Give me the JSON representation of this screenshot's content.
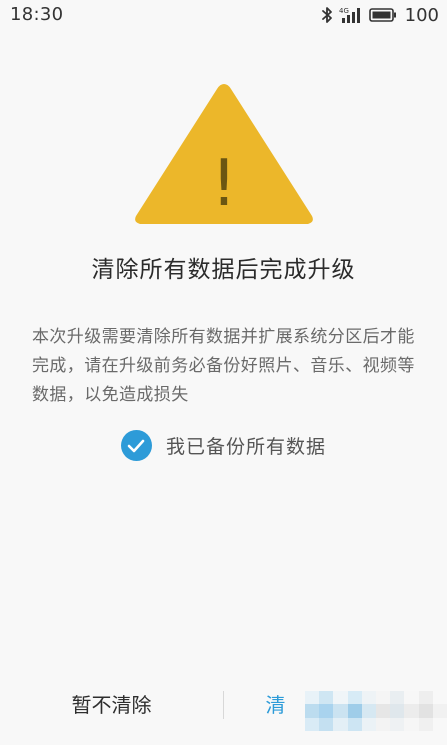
{
  "status_bar": {
    "time": "18:30",
    "network": "4G",
    "battery": "100",
    "icons": [
      "bluetooth-icon",
      "signal-icon",
      "battery-icon"
    ]
  },
  "warning": {
    "icon": "warning-icon",
    "color": "#ECB72A",
    "glyph": "!"
  },
  "title": "清除所有数据后完成升级",
  "description": "本次升级需要清除所有数据并扩展系统分区后才能完成，请在升级前务必备份好照片、音乐、视频等数据，以免造成损失",
  "checkbox": {
    "label": "我已备份所有数据",
    "checked": true,
    "color": "#2D9BD8"
  },
  "buttons": {
    "cancel": "暂不清除",
    "confirm": "清"
  },
  "colors": {
    "accent": "#2D9BD8",
    "background": "#F8F8F8"
  }
}
